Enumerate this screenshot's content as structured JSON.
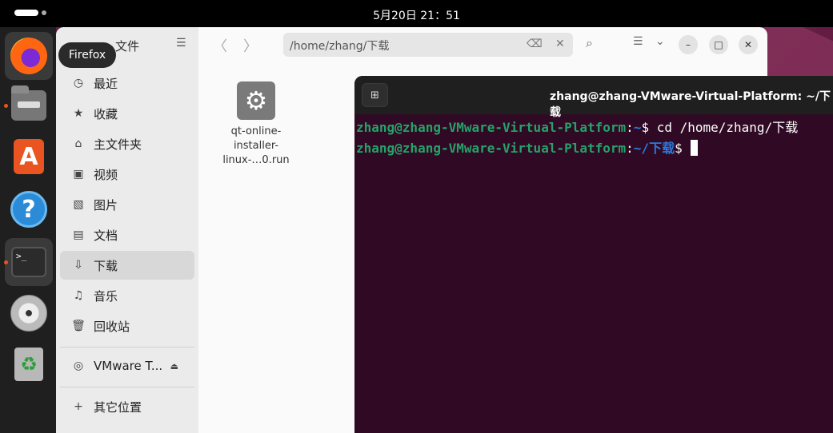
{
  "topbar": {
    "clock": "5月20日  21：51"
  },
  "dock": {
    "items": [
      {
        "name": "Firefox",
        "icon": "firefox-icon"
      },
      {
        "name": "文件",
        "icon": "files-icon"
      },
      {
        "name": "App Center",
        "icon": "store-icon",
        "glyph": "A"
      },
      {
        "name": "Help",
        "icon": "help-icon",
        "glyph": "?"
      },
      {
        "name": "Terminal",
        "icon": "terminal-icon",
        "glyph": ">_"
      },
      {
        "name": "DVD",
        "icon": "dvd-icon"
      },
      {
        "name": "Trash",
        "icon": "trash-icon",
        "glyph": "♻"
      }
    ],
    "tooltip": "Firefox"
  },
  "files": {
    "title": "文件",
    "sidebar": {
      "items": [
        {
          "label": "最近",
          "icon": "clock-icon",
          "glyph": "◷"
        },
        {
          "label": "收藏",
          "icon": "star-icon",
          "glyph": "★"
        },
        {
          "label": "主文件夹",
          "icon": "home-icon",
          "glyph": "⌂"
        },
        {
          "label": "视频",
          "icon": "video-icon",
          "glyph": "▣"
        },
        {
          "label": "图片",
          "icon": "image-icon",
          "glyph": "▧"
        },
        {
          "label": "文档",
          "icon": "document-icon",
          "glyph": "▤"
        },
        {
          "label": "下载",
          "icon": "download-icon",
          "glyph": "⇩"
        },
        {
          "label": "音乐",
          "icon": "music-icon",
          "glyph": "♫"
        },
        {
          "label": "回收站",
          "icon": "trash-icon",
          "glyph": "🗑"
        }
      ],
      "volume": {
        "label": "VMware T...",
        "icon": "disc-icon",
        "glyph": "◎",
        "eject_glyph": "⏏"
      },
      "other": {
        "label": "其它位置",
        "glyph": "+"
      }
    },
    "header": {
      "back_glyph": "〈",
      "forward_glyph": "〉",
      "path": "/home/zhang/下载",
      "clear_glyph": "⌫",
      "close_glyph": "✕",
      "search_glyph": "⌕",
      "view_glyph": "☰",
      "dropdown_glyph": "⌄",
      "minimize_glyph": "–",
      "maximize_glyph": "□",
      "window_close_glyph": "✕"
    },
    "file": {
      "name_line1": "qt-online-",
      "name_line2": "installer-",
      "name_line3": "linux-…0.run",
      "icon_glyph": "⚙"
    }
  },
  "terminal": {
    "new_tab_glyph": "⊞",
    "title": "zhang@zhang-VMware-Virtual-Platform: ~/下载",
    "lines": [
      {
        "user": "zhang@zhang-VMware-Virtual-Platform",
        "sep": ":",
        "path": "~",
        "prompt": "$ ",
        "cmd": "cd /home/zhang/下载"
      },
      {
        "user": "zhang@zhang-VMware-Virtual-Platform",
        "sep": ":",
        "path": "~/下载",
        "prompt": "$ ",
        "cmd": ""
      }
    ]
  },
  "colors": {
    "accent": "#e95420",
    "terminal_bg": "#300a24",
    "prompt_user": "#26a269",
    "prompt_path": "#2a7bde"
  }
}
